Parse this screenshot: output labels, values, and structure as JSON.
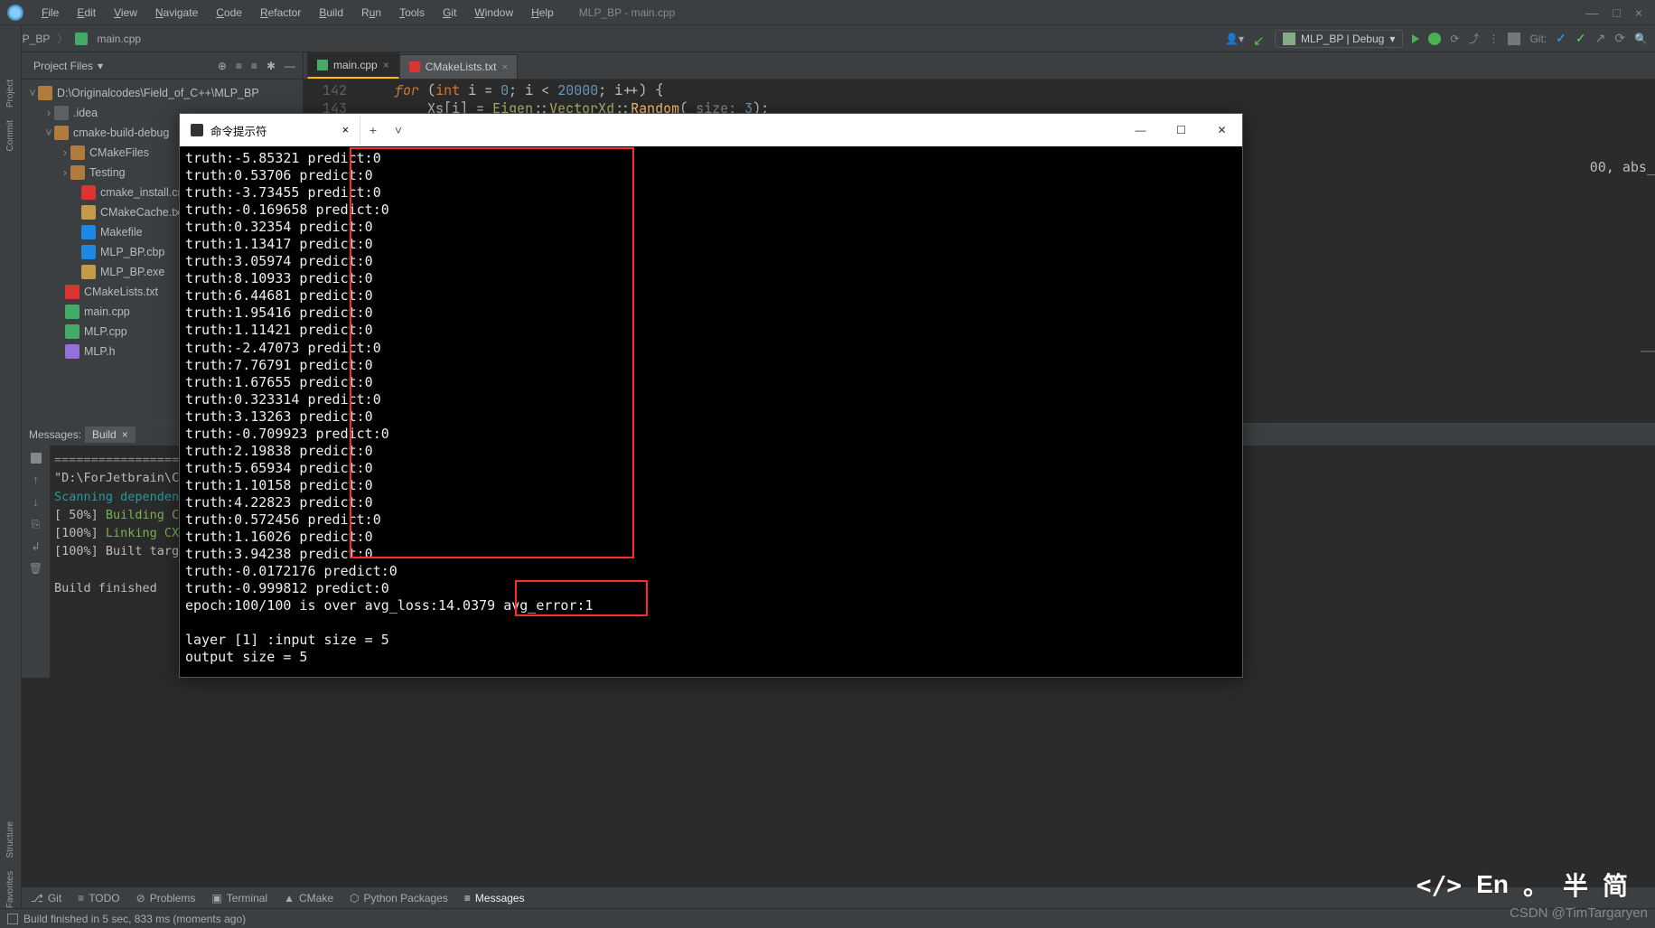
{
  "window": {
    "title_context": "MLP_BP - main.cpp",
    "min": "—",
    "max": "□",
    "close": "×"
  },
  "menu": {
    "file": "File",
    "edit": "Edit",
    "view": "View",
    "navigate": "Navigate",
    "code": "Code",
    "refactor": "Refactor",
    "build": "Build",
    "run": "Run",
    "tools": "Tools",
    "git": "Git",
    "window": "Window",
    "help": "Help"
  },
  "breadcrumb": {
    "project": "MLP_BP",
    "file": "main.cpp"
  },
  "run_config": {
    "label": "MLP_BP | Debug",
    "git_label": "Git:"
  },
  "leftstrip": {
    "project": "Project",
    "commit": "Commit",
    "structure": "Structure",
    "favorites": "Favorites"
  },
  "project_pane": {
    "selector": "Project Files",
    "root": "D:\\Originalcodes\\Field_of_C++\\MLP_BP",
    "idea": ".idea",
    "cbd": "cmake-build-debug",
    "cmakefiles": "CMakeFiles",
    "testing": "Testing",
    "cmake_install": "cmake_install.cmake",
    "cmakecache": "CMakeCache.txt",
    "makefile": "Makefile",
    "cbp": "MLP_BP.cbp",
    "exe": "MLP_BP.exe",
    "cmakelists": "CMakeLists.txt",
    "maincpp": "main.cpp",
    "mlpcpp": "MLP.cpp",
    "mlph": "MLP.h"
  },
  "editor": {
    "tab1": "main.cpp",
    "tab2": "CMakeLists.txt",
    "l142": "142",
    "l143": "143",
    "code142": "for (int i = 0; i < 20000; i++) {",
    "code143_pre": "    Xs[i] = Eigen::VectorXd::Random(",
    "code143_hint": " size: ",
    "code143_post": "3);",
    "trail": "00,  abs_"
  },
  "terminal": {
    "tab_title": "命令提示符",
    "lines": [
      "truth:-5.85321 predict:0",
      "truth:0.53706 predict:0",
      "truth:-3.73455 predict:0",
      "truth:-0.169658 predict:0",
      "truth:0.32354 predict:0",
      "truth:1.13417 predict:0",
      "truth:3.05974 predict:0",
      "truth:8.10933 predict:0",
      "truth:6.44681 predict:0",
      "truth:1.95416 predict:0",
      "truth:1.11421 predict:0",
      "truth:-2.47073 predict:0",
      "truth:7.76791 predict:0",
      "truth:1.67655 predict:0",
      "truth:0.323314 predict:0",
      "truth:3.13263 predict:0",
      "truth:-0.709923 predict:0",
      "truth:2.19838 predict:0",
      "truth:5.65934 predict:0",
      "truth:1.10158 predict:0",
      "truth:4.22823 predict:0",
      "truth:0.572456 predict:0",
      "truth:1.16026 predict:0",
      "truth:3.94238 predict:0",
      "truth:-0.0172176 predict:0",
      "truth:-0.999812 predict:0",
      " epoch:100/100 is over avg_loss:14.0379 avg_error:1",
      "",
      "layer [1] :input size = 5",
      "output size = 5"
    ]
  },
  "messages": {
    "label": "Messages:",
    "tab": "Build",
    "body": [
      "====================",
      "\"D:\\ForJetbrain\\CL",
      "Scanning dependenc",
      "[ 50%] Building CX",
      "[100%] Linking CXX",
      "[100%] Built targe",
      "",
      "Build finished"
    ]
  },
  "bottom": {
    "git": "Git",
    "todo": "TODO",
    "problems": "Problems",
    "terminal": "Terminal",
    "cmake": "CMake",
    "python": "Python Packages",
    "messages": "Messages"
  },
  "status": {
    "text": "Build finished in 5 sec, 833 ms (moments ago)"
  },
  "ime": {
    "code": "</>",
    "en": "En",
    "dot": "。",
    "ban": "半",
    "jian": "简"
  },
  "watermark": "CSDN @TimTargaryen"
}
